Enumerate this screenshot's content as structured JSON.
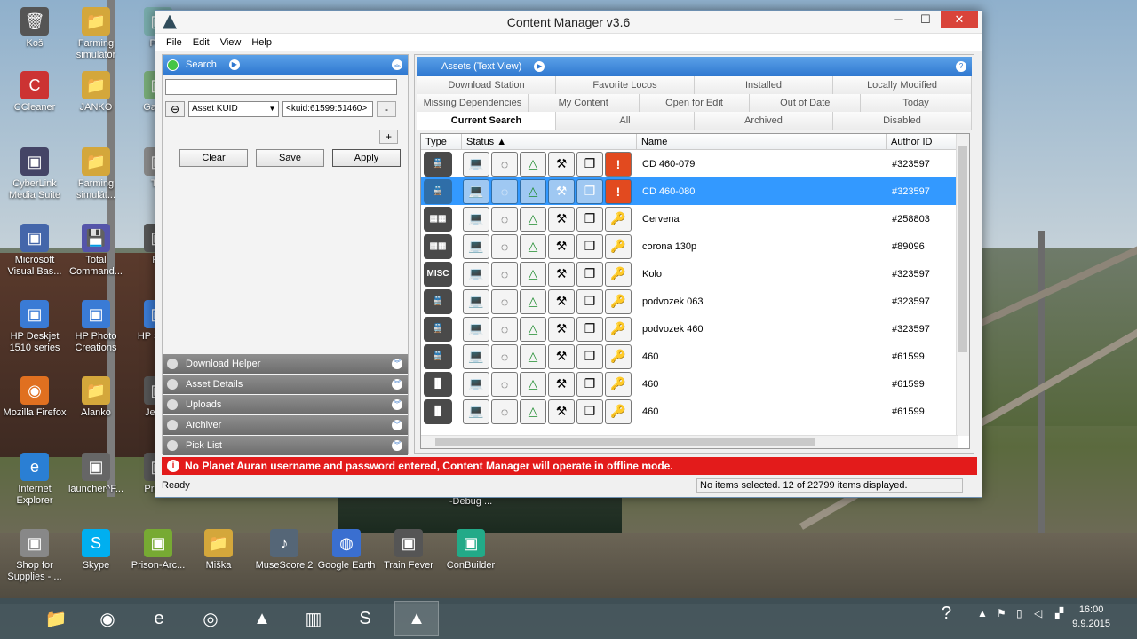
{
  "desktop": {
    "icons": [
      {
        "label": "Koš",
        "glyph": "🗑"
      },
      {
        "label": "Farming simulátor",
        "glyph": "📁"
      },
      {
        "label": "Pov",
        "glyph": "▣"
      },
      {
        "label": "CCleaner",
        "glyph": "C"
      },
      {
        "label": "JANKO",
        "glyph": "📁"
      },
      {
        "label": "Ga Tru",
        "glyph": "▣"
      },
      {
        "label": "CyberLink Media Suite",
        "glyph": "▣"
      },
      {
        "label": "Farming simulát...",
        "glyph": "📁"
      },
      {
        "label": "Tra",
        "glyph": "▣"
      },
      {
        "label": "Microsoft Visual Bas...",
        "glyph": "▣"
      },
      {
        "label": "Total Command...",
        "glyph": "💾"
      },
      {
        "label": "Po",
        "glyph": "▣"
      },
      {
        "label": "HP Deskjet 1510 series",
        "glyph": "▣"
      },
      {
        "label": "HP Photo Creations",
        "glyph": "▣"
      },
      {
        "label": "HP S Ass",
        "glyph": "▣"
      },
      {
        "label": "Mozilla Firefox",
        "glyph": "◉"
      },
      {
        "label": "Alanko",
        "glyph": "📁"
      },
      {
        "label": "Jedno",
        "glyph": "▣"
      },
      {
        "label": "Internet Explorer",
        "glyph": "e"
      },
      {
        "label": "launcher^F...",
        "glyph": "▣"
      },
      {
        "label": "Prison",
        "glyph": "▣"
      },
      {
        "label": "Shop for Supplies - ...",
        "glyph": "▣"
      },
      {
        "label": "Skype",
        "glyph": "S"
      },
      {
        "label": "Prison-Arc...",
        "glyph": "▣"
      },
      {
        "label": "Miška",
        "glyph": "📁"
      },
      {
        "label": "MuseScore 2",
        "glyph": "♪"
      },
      {
        "label": "Google Earth",
        "glyph": "◍"
      },
      {
        "label": "Train Fever",
        "glyph": "▣"
      },
      {
        "label": "ConBuilder",
        "glyph": "▣"
      },
      {
        "label": "-Debug ...",
        "glyph": ""
      }
    ]
  },
  "window": {
    "title": "Content Manager v3.6",
    "minimize": "─",
    "maximize": "☐",
    "close": "✕"
  },
  "menu": [
    "File",
    "Edit",
    "View",
    "Help"
  ],
  "search_panel": {
    "title": "Search",
    "query": "",
    "kuid_type": "Asset KUID",
    "kuid_value": "<kuid:61599:51460>",
    "minus_label": "-",
    "plus_label": "+",
    "clear_label": "Clear",
    "save_label": "Save",
    "apply_label": "Apply"
  },
  "accordion": [
    "Download Helper",
    "Asset Details",
    "Uploads",
    "Archiver",
    "Pick List"
  ],
  "assets_panel": {
    "title": "Assets (Text View)",
    "help": "?",
    "tabs_row1": [
      "Download Station",
      "Favorite Locos",
      "Installed",
      "Locally Modified"
    ],
    "tabs_row2": [
      "Missing Dependencies",
      "My Content",
      "Open for Edit",
      "Out of Date",
      "Today"
    ],
    "tabs_row3": [
      "Current Search",
      "All",
      "Archived",
      "Disabled"
    ],
    "active_tab": "Current Search",
    "columns": [
      "Type",
      "Status",
      "Name",
      "Author ID"
    ],
    "rows": [
      {
        "type": "loco",
        "name": "CD 460-079",
        "author": "#323597",
        "selected": false,
        "alert": true
      },
      {
        "type": "loco",
        "name": "CD 460-080",
        "author": "#323597",
        "selected": true,
        "alert": true
      },
      {
        "type": "dep",
        "name": "Cervena",
        "author": "#258803",
        "selected": false,
        "alert": false
      },
      {
        "type": "dep",
        "name": "corona 130p",
        "author": "#89096",
        "selected": false,
        "alert": false
      },
      {
        "type": "MISC",
        "name": "Kolo",
        "author": "#323597",
        "selected": false,
        "alert": false
      },
      {
        "type": "loco",
        "name": "podvozek 063",
        "author": "#323597",
        "selected": false,
        "alert": false
      },
      {
        "type": "loco",
        "name": "podvozek 460",
        "author": "#323597",
        "selected": false,
        "alert": false
      },
      {
        "type": "loco",
        "name": "460",
        "author": "#61599",
        "selected": false,
        "alert": false
      },
      {
        "type": "cabin",
        "name": "460",
        "author": "#61599",
        "selected": false,
        "alert": false
      },
      {
        "type": "cabin",
        "name": "460",
        "author": "#61599",
        "selected": false,
        "alert": false
      }
    ]
  },
  "offline_message": "No Planet Auran username and password entered, Content Manager will operate in offline mode.",
  "status": {
    "left": "Ready",
    "right": "No items selected. 12 of 22799 items displayed."
  },
  "taskbar": {
    "time": "16:00",
    "date": "9.9.2015"
  }
}
